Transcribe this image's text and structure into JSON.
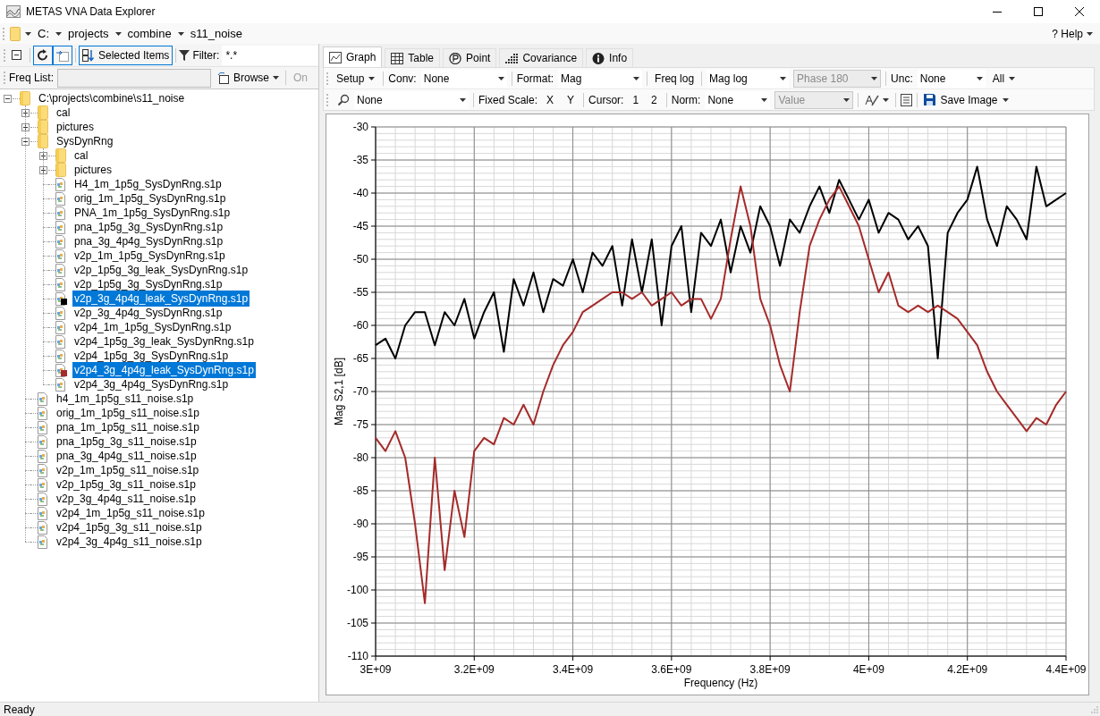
{
  "window": {
    "title": "METAS VNA Data Explorer"
  },
  "breadcrumb": [
    "C:",
    "projects",
    "combine",
    "s11_noise"
  ],
  "help": {
    "icon": "?",
    "label": "Help"
  },
  "left_toolbar": {
    "sort": "Selected Items",
    "filter_label": "Filter:",
    "filter": "*.*"
  },
  "freq_list": {
    "label": "Freq List:",
    "disabled": true,
    "browse": "Browse",
    "on": {
      "label": "On",
      "disabled": true
    }
  },
  "tree": {
    "label": "C:\\projects\\combine\\s11_noise",
    "kind": "folder",
    "expanded": true,
    "selected": false,
    "children": [
      {
        "label": "cal",
        "kind": "folder",
        "expanded": false,
        "selected": false
      },
      {
        "label": "pictures",
        "kind": "folder",
        "expanded": false,
        "selected": false
      },
      {
        "label": "SysDynRng",
        "kind": "folder",
        "expanded": true,
        "selected": false,
        "children": [
          {
            "label": "cal",
            "kind": "folder",
            "expanded": false,
            "selected": false
          },
          {
            "label": "pictures",
            "kind": "folder",
            "expanded": false,
            "selected": false
          },
          {
            "label": "H4_1m_1p5g_SysDynRng.s1p",
            "kind": "file",
            "selected": false
          },
          {
            "label": "orig_1m_1p5g_SysDynRng.s1p",
            "kind": "file",
            "selected": false
          },
          {
            "label": "PNA_1m_1p5g_SysDynRng.s1p",
            "kind": "file",
            "selected": false
          },
          {
            "label": "pna_1p5g_3g_SysDynRng.s1p",
            "kind": "file",
            "selected": false
          },
          {
            "label": "pna_3g_4p4g_SysDynRng.s1p",
            "kind": "file",
            "selected": false
          },
          {
            "label": "v2p_1m_1p5g_SysDynRng.s1p",
            "kind": "file",
            "selected": false
          },
          {
            "label": "v2p_1p5g_3g_leak_SysDynRng.s1p",
            "kind": "file",
            "selected": false
          },
          {
            "label": "v2p_1p5g_3g_SysDynRng.s1p",
            "kind": "file",
            "selected": false
          },
          {
            "label": "v2p_3g_4p4g_leak_SysDynRng.s1p",
            "kind": "file",
            "selected": true,
            "color": "#000000"
          },
          {
            "label": "v2p_3g_4p4g_SysDynRng.s1p",
            "kind": "file",
            "selected": false
          },
          {
            "label": "v2p4_1m_1p5g_SysDynRng.s1p",
            "kind": "file",
            "selected": false
          },
          {
            "label": "v2p4_1p5g_3g_leak_SysDynRng.s1p",
            "kind": "file",
            "selected": false
          },
          {
            "label": "v2p4_1p5g_3g_SysDynRng.s1p",
            "kind": "file",
            "selected": false
          },
          {
            "label": "v2p4_3g_4p4g_leak_SysDynRng.s1p",
            "kind": "file",
            "selected": true,
            "color": "#a52a2a"
          },
          {
            "label": "v2p4_3g_4p4g_SysDynRng.s1p",
            "kind": "file",
            "selected": false
          }
        ]
      },
      {
        "label": "h4_1m_1p5g_s11_noise.s1p",
        "kind": "file",
        "selected": false
      },
      {
        "label": "orig_1m_1p5g_s11_noise.s1p",
        "kind": "file",
        "selected": false
      },
      {
        "label": "pna_1m_1p5g_s11_noise.s1p",
        "kind": "file",
        "selected": false
      },
      {
        "label": "pna_1p5g_3g_s11_noise.s1p",
        "kind": "file",
        "selected": false
      },
      {
        "label": "pna_3g_4p4g_s11_noise.s1p",
        "kind": "file",
        "selected": false
      },
      {
        "label": "v2p_1m_1p5g_s11_noise.s1p",
        "kind": "file",
        "selected": false
      },
      {
        "label": "v2p_1p5g_3g_s11_noise.s1p",
        "kind": "file",
        "selected": false
      },
      {
        "label": "v2p_3g_4p4g_s11_noise.s1p",
        "kind": "file",
        "selected": false
      },
      {
        "label": "v2p4_1m_1p5g_s11_noise.s1p",
        "kind": "file",
        "selected": false
      },
      {
        "label": "v2p4_1p5g_3g_s11_noise.s1p",
        "kind": "file",
        "selected": false
      },
      {
        "label": "v2p4_3g_4p4g_s11_noise.s1p",
        "kind": "file",
        "selected": false
      }
    ]
  },
  "tabs": [
    {
      "label": "Graph",
      "selected": true
    },
    {
      "label": "Table",
      "selected": false
    },
    {
      "label": "Point",
      "selected": false
    },
    {
      "label": "Covariance",
      "selected": false
    },
    {
      "label": "Info",
      "selected": false
    }
  ],
  "graph_toolbar": {
    "setup": "Setup",
    "conv": {
      "label": "Conv:",
      "value": "None"
    },
    "format": {
      "label": "Format:",
      "value": "Mag"
    },
    "freq_log": "Freq log",
    "mag_log": {
      "value": "Mag log",
      "disabled": false
    },
    "phase": {
      "value": "Phase 180",
      "disabled": true
    },
    "unc": {
      "label": "Unc:",
      "value": "None"
    },
    "all": "All"
  },
  "graph_toolbar_2": {
    "search": {
      "value": "None"
    },
    "fixed_scale": {
      "label": "Fixed Scale:",
      "x": "X",
      "y": "Y"
    },
    "cursor": {
      "label": "Cursor:",
      "options": [
        "1",
        "2"
      ]
    },
    "norm": {
      "label": "Norm:",
      "value": "None"
    },
    "norm_value": {
      "value": "Value",
      "disabled": true
    },
    "save_image": "Save Image"
  },
  "graph": {
    "chart_data": {
      "type": "line",
      "grid": true,
      "xlabel": "Frequency (Hz)",
      "ylabel": "Mag S2,1 [dB]",
      "xlim": [
        3000000000.0,
        4400000000.0
      ],
      "ylim": [
        -110,
        -30
      ],
      "xticks": [
        {
          "value": 3000000000.0,
          "label": "3E+09"
        },
        {
          "value": 3200000000.0,
          "label": "3.2E+09"
        },
        {
          "value": 3400000000.0,
          "label": "3.4E+09"
        },
        {
          "value": 3600000000.0,
          "label": "3.6E+09"
        },
        {
          "value": 3800000000.0,
          "label": "3.8E+09"
        },
        {
          "value": 4000000000.0,
          "label": "4E+09"
        },
        {
          "value": 4200000000.0,
          "label": "4.2E+09"
        },
        {
          "value": 4400000000.0,
          "label": "4.4E+09"
        }
      ],
      "yticks": [
        -30,
        -35,
        -40,
        -45,
        -50,
        -55,
        -60,
        -65,
        -70,
        -75,
        -80,
        -85,
        -90,
        -95,
        -100,
        -105,
        -110
      ],
      "x": [
        3000000000.0,
        3020000000.0,
        3040000000.0,
        3060000000.0,
        3080000000.0,
        3100000000.0,
        3120000000.0,
        3140000000.0,
        3160000000.0,
        3180000000.0,
        3200000000.0,
        3220000000.0,
        3240000000.0,
        3260000000.0,
        3280000000.0,
        3300000000.0,
        3320000000.0,
        3340000000.0,
        3360000000.0,
        3380000000.0,
        3400000000.0,
        3420000000.0,
        3440000000.0,
        3460000000.0,
        3480000000.0,
        3500000000.0,
        3520000000.0,
        3540000000.0,
        3560000000.0,
        3580000000.0,
        3600000000.0,
        3620000000.0,
        3640000000.0,
        3660000000.0,
        3680000000.0,
        3700000000.0,
        3720000000.0,
        3740000000.0,
        3760000000.0,
        3780000000.0,
        3800000000.0,
        3820000000.0,
        3840000000.0,
        3860000000.0,
        3880000000.0,
        3900000000.0,
        3920000000.0,
        3940000000.0,
        3960000000.0,
        3980000000.0,
        4000000000.0,
        4020000000.0,
        4040000000.0,
        4060000000.0,
        4080000000.0,
        4100000000.0,
        4120000000.0,
        4140000000.0,
        4160000000.0,
        4180000000.0,
        4200000000.0,
        4220000000.0,
        4240000000.0,
        4260000000.0,
        4280000000.0,
        4300000000.0,
        4320000000.0,
        4340000000.0,
        4360000000.0,
        4380000000.0,
        4400000000.0
      ],
      "series": [
        {
          "color": "#000000",
          "values": [
            -63,
            -62,
            -65,
            -60,
            -58,
            -58,
            -63,
            -58,
            -60,
            -56,
            -62,
            -58,
            -55,
            -64,
            -53,
            -57,
            -52,
            -58,
            -53,
            -54,
            -50,
            -55,
            -49,
            -51,
            -48,
            -57,
            -47,
            -55,
            -47,
            -60,
            -48,
            -45,
            -58,
            -46,
            -48,
            -44,
            -52,
            -45,
            -49,
            -42,
            -45,
            -51,
            -44,
            -46,
            -42,
            -39,
            -43,
            -38,
            -41,
            -44,
            -41,
            -46,
            -43,
            -44,
            -47,
            -45,
            -48,
            -65,
            -46,
            -43,
            -41,
            -36,
            -44,
            -48,
            -42,
            -44,
            -47,
            -36,
            -42,
            -41,
            -40
          ]
        },
        {
          "color": "#a52a2a",
          "values": [
            -77,
            -79,
            -76,
            -80,
            -90,
            -102,
            -80,
            -97,
            -85,
            -92,
            -79,
            -77,
            -78,
            -74,
            -75,
            -72,
            -75,
            -70,
            -66,
            -63,
            -61,
            -58,
            -57,
            -56,
            -55,
            -55,
            -56,
            -55,
            -57,
            -56,
            -55,
            -57,
            -56,
            -56,
            -59,
            -56,
            -47,
            -39,
            -45,
            -56,
            -60,
            -66,
            -70,
            -58,
            -48,
            -44,
            -41,
            -39,
            -42,
            -45,
            -50,
            -55,
            -52,
            -57,
            -58,
            -57,
            -58,
            -57,
            -58,
            -59,
            -61,
            -63,
            -67,
            -70,
            -72,
            -74,
            -76,
            -74,
            -75,
            -72,
            -70
          ]
        }
      ]
    }
  },
  "status_bar": "Ready"
}
